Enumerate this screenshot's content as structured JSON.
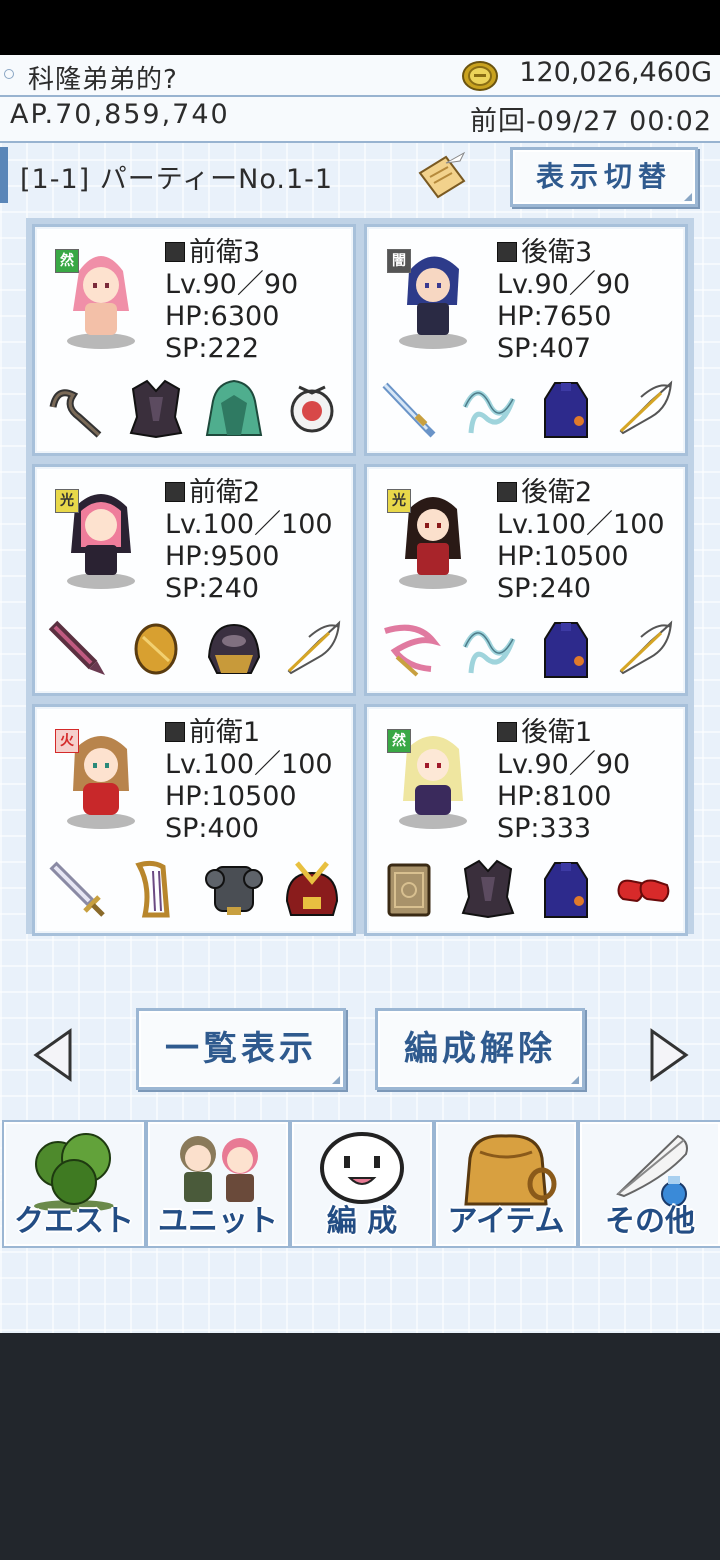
{
  "status": {
    "player_name": "科隆弟弟的?",
    "gold": "120,026,460G",
    "ap": "AP.70,859,740",
    "last_login": "前回-09/27 00:02"
  },
  "party": {
    "title": "[1-1] パーティーNo.1-1",
    "toggle_label": "表示切替"
  },
  "cards": [
    {
      "element": "然",
      "element_color": "#39a845",
      "position": "前衛3",
      "level": "Lv.90／90",
      "hp": "HP:6300",
      "sp": "SP:222",
      "equipment": [
        "whip-icon",
        "dark-armor-icon",
        "green-cloak-icon",
        "amulet-icon"
      ]
    },
    {
      "element": "闇",
      "element_color": "#555555",
      "position": "後衛3",
      "level": "Lv.90／90",
      "hp": "HP:7650",
      "sp": "SP:407",
      "equipment": [
        "blade-icon",
        "ribbon-icon",
        "robe-icon",
        "feather-icon"
      ]
    },
    {
      "element": "光",
      "element_color": "#e8d84a",
      "position": "前衛2",
      "level": "Lv.100／100",
      "hp": "HP:9500",
      "sp": "SP:240",
      "equipment": [
        "sword-icon",
        "shield-icon",
        "helmet-icon",
        "feather-icon"
      ]
    },
    {
      "element": "光",
      "element_color": "#e8d84a",
      "position": "後衛2",
      "level": "Lv.100／100",
      "hp": "HP:10500",
      "sp": "SP:240",
      "equipment": [
        "bow-icon",
        "ribbon-icon",
        "robe-icon",
        "feather-icon"
      ]
    },
    {
      "element": "火",
      "element_color": "#e23a3a",
      "position": "前衛1",
      "level": "Lv.100／100",
      "hp": "HP:10500",
      "sp": "SP:400",
      "equipment": [
        "sword-icon",
        "harp-icon",
        "heavy-armor-icon",
        "samurai-helmet-icon"
      ]
    },
    {
      "element": "然",
      "element_color": "#39a845",
      "position": "後衛1",
      "level": "Lv.90／90",
      "hp": "HP:8100",
      "sp": "SP:333",
      "equipment": [
        "tome-icon",
        "dark-armor-icon",
        "robe-icon",
        "boots-icon"
      ]
    }
  ],
  "actions": {
    "list_label": "一覧表示",
    "release_label": "編成解除"
  },
  "menu": [
    {
      "label": "クエスト",
      "icon": "tree-icon"
    },
    {
      "label": "ユニット",
      "icon": "characters-icon"
    },
    {
      "label": "編 成",
      "icon": "face-icon"
    },
    {
      "label": "アイテム",
      "icon": "bag-icon"
    },
    {
      "label": "その他",
      "icon": "quill-icon"
    }
  ]
}
